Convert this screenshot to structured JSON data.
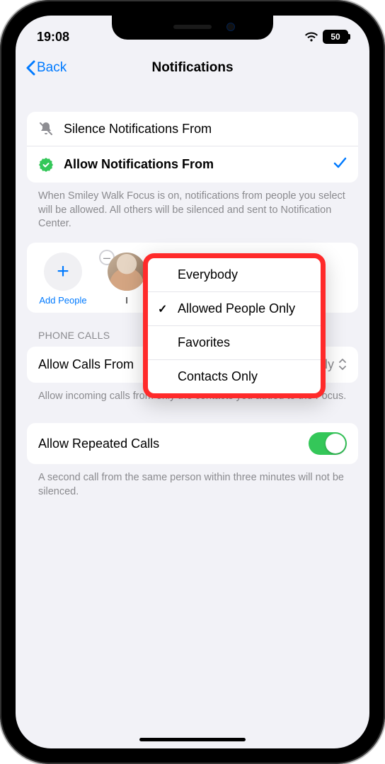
{
  "status": {
    "time": "19:08",
    "battery": "50"
  },
  "nav": {
    "back": "Back",
    "title": "Notifications"
  },
  "modeList": {
    "silence": "Silence Notifications From",
    "allow": "Allow Notifications From"
  },
  "explanation": "When Smiley Walk Focus is on, notifications from people you select will be allowed. All others will be silenced and sent to Notification Center.",
  "people": {
    "add": "Add People",
    "contact1_initial": "I"
  },
  "sectionPhone": "PHONE CALLS",
  "callsFrom": {
    "label": "Allow Calls From",
    "value": "Allowed People Only"
  },
  "callsExplain": "Allow incoming calls from only the contacts you added to the Focus.",
  "repeated": {
    "label": "Allow Repeated Calls"
  },
  "repeatedExplain": "A second call from the same person within three minutes will not be silenced.",
  "popover": {
    "opt1": "Everybody",
    "opt2": "Allowed People Only",
    "opt3": "Favorites",
    "opt4": "Contacts Only",
    "selectedIndex": 1
  }
}
